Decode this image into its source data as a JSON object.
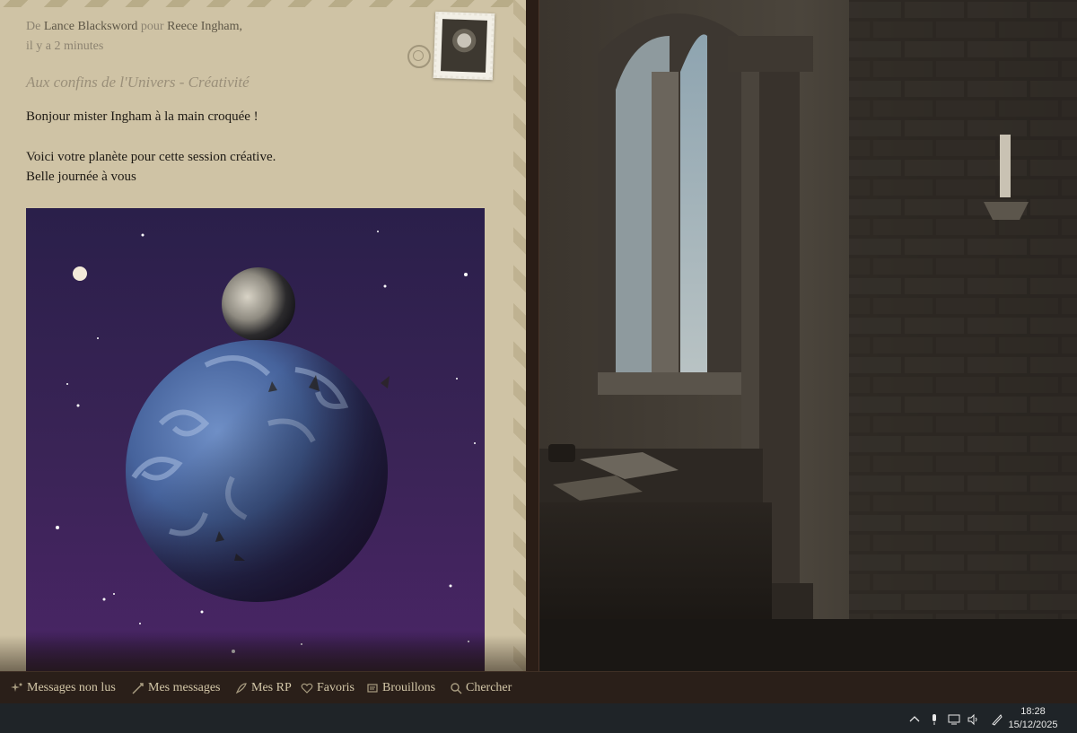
{
  "letter": {
    "from_prefix": "De",
    "from_name": "Lance Blacksword",
    "for_prefix": "pour",
    "to_name": "Reece Ingham,",
    "time": "il y a 2 minutes",
    "subject": "Aux confins de l'Univers - Créativité",
    "line1": "Bonjour mister Ingham à la main croquée !",
    "line2": "Voici votre planète pour cette session créative.",
    "line3": "Belle journée à vous"
  },
  "nav": {
    "unread": "Messages non lus",
    "my_messages": "Mes messages",
    "my_rp": "Mes RP",
    "favorites": "Favoris",
    "drafts": "Brouillons",
    "search": "Chercher"
  },
  "taskbar": {
    "time": "18:28",
    "date": "15/12/2025"
  },
  "colors": {
    "paper": "#cfc3a5",
    "nav_bg": "#2a1f19",
    "nav_text": "#d3c7a8",
    "space_purple": "#3b2457"
  }
}
